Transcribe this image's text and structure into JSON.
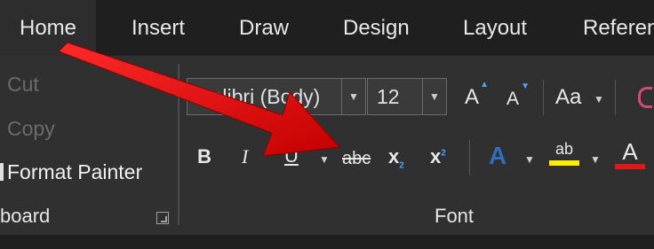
{
  "tabs": [
    "Home",
    "Insert",
    "Draw",
    "Design",
    "Layout",
    "Referen"
  ],
  "clipboard": {
    "cut_label": "Cut",
    "copy_label": "Copy",
    "format_painter_label": "Format Painter",
    "group_label": "board"
  },
  "font_group": {
    "font_name": "Calibri (Body)",
    "font_size": "12",
    "grow_label": "A",
    "shrink_label": "A",
    "change_case_label": "Aa",
    "bold_label": "B",
    "italic_label": "I",
    "underline_label": "U",
    "strike_label": "abc",
    "subscript_label": "x",
    "subscript_mark": "2",
    "superscript_label": "x",
    "superscript_mark": "2",
    "text_effects_label": "A",
    "highlight_label": "ab",
    "font_color_label": "A",
    "group_label": "Font"
  },
  "colors": {
    "annotation_arrow": "#e60000",
    "highlight": "#ffee00",
    "font_color": "#e01818",
    "text_effects": "#4a8de0"
  }
}
